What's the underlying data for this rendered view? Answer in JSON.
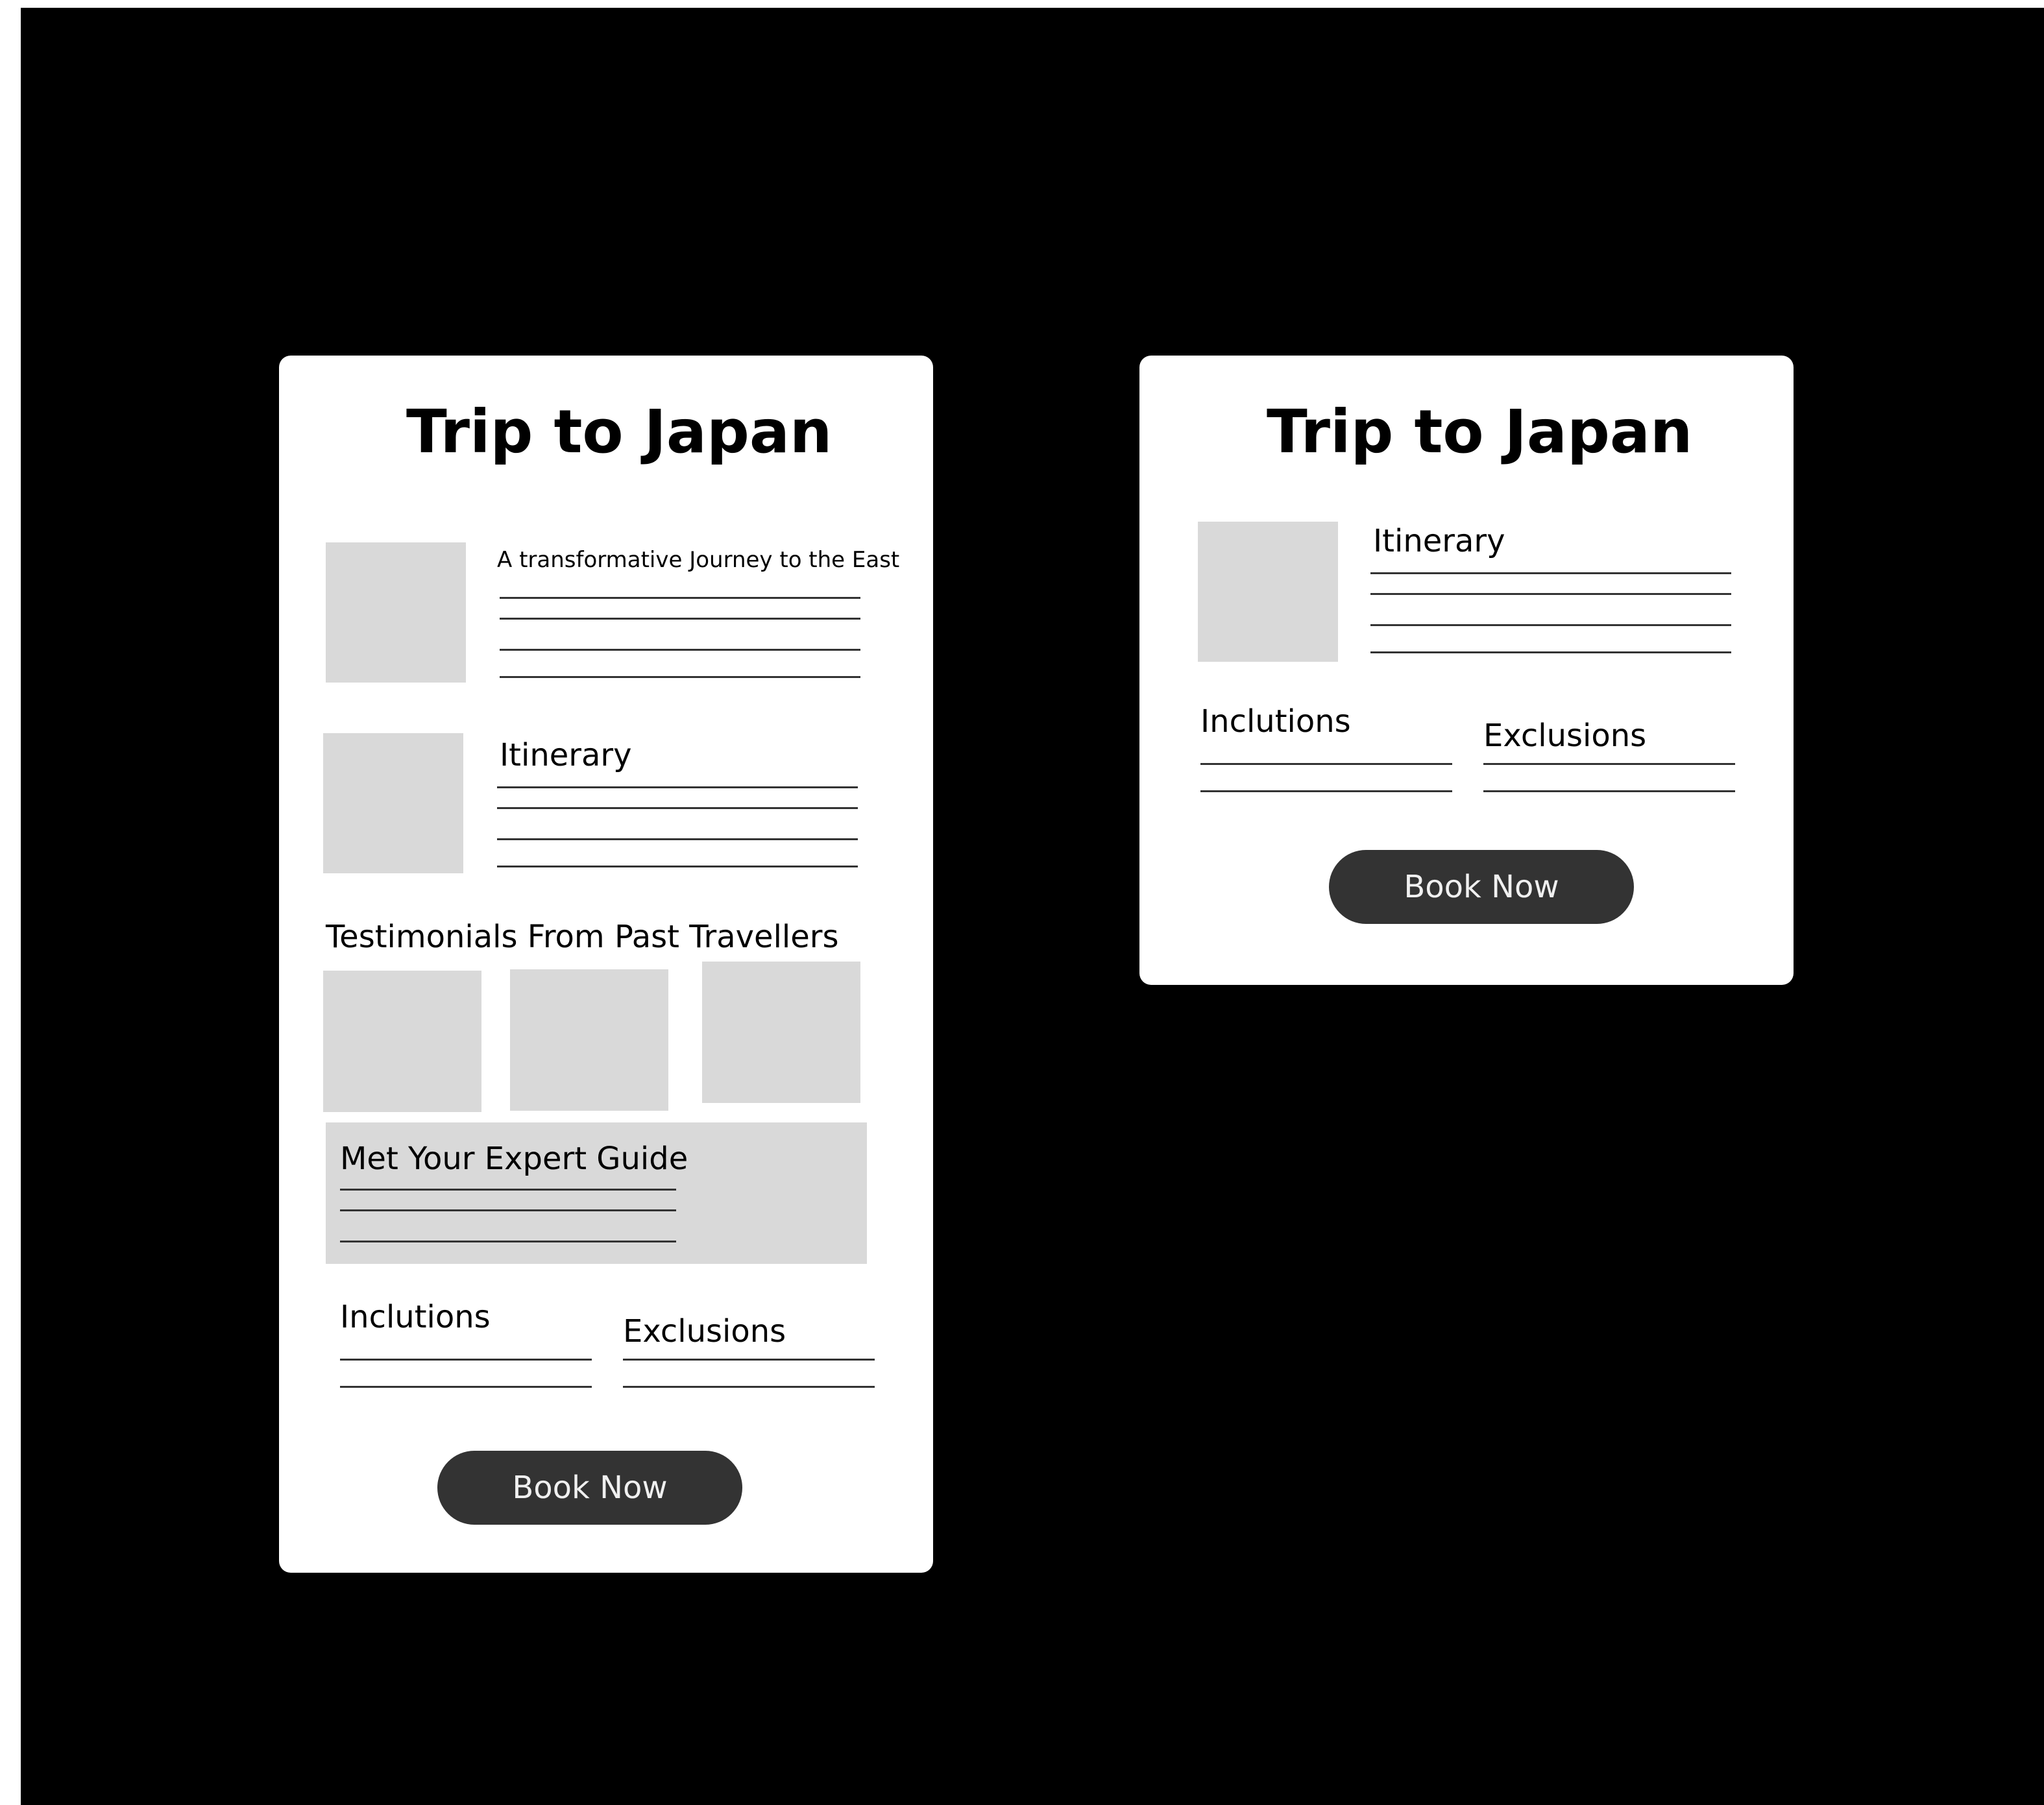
{
  "mobile_card": {
    "title": "Trip to Japan",
    "intro_heading": "A transformative Journey to the East",
    "itinerary_label": "Itinerary",
    "testimonials_label": "Testimonials From Past Travellers",
    "guide_label": "Met Your Expert Guide",
    "inclusions_label": "Inclutions",
    "exclusions_label": "Exclusions",
    "book_label": "Book Now"
  },
  "compact_card": {
    "title": "Trip to Japan",
    "itinerary_label": "Itinerary",
    "inclusions_label": "Inclutions",
    "exclusions_label": "Exclusions",
    "book_label": "Book Now"
  },
  "colors": {
    "background": "#000000",
    "card": "#ffffff",
    "placeholder": "#d9d9d9",
    "button": "#333333",
    "button_text": "#f0f0f0"
  }
}
